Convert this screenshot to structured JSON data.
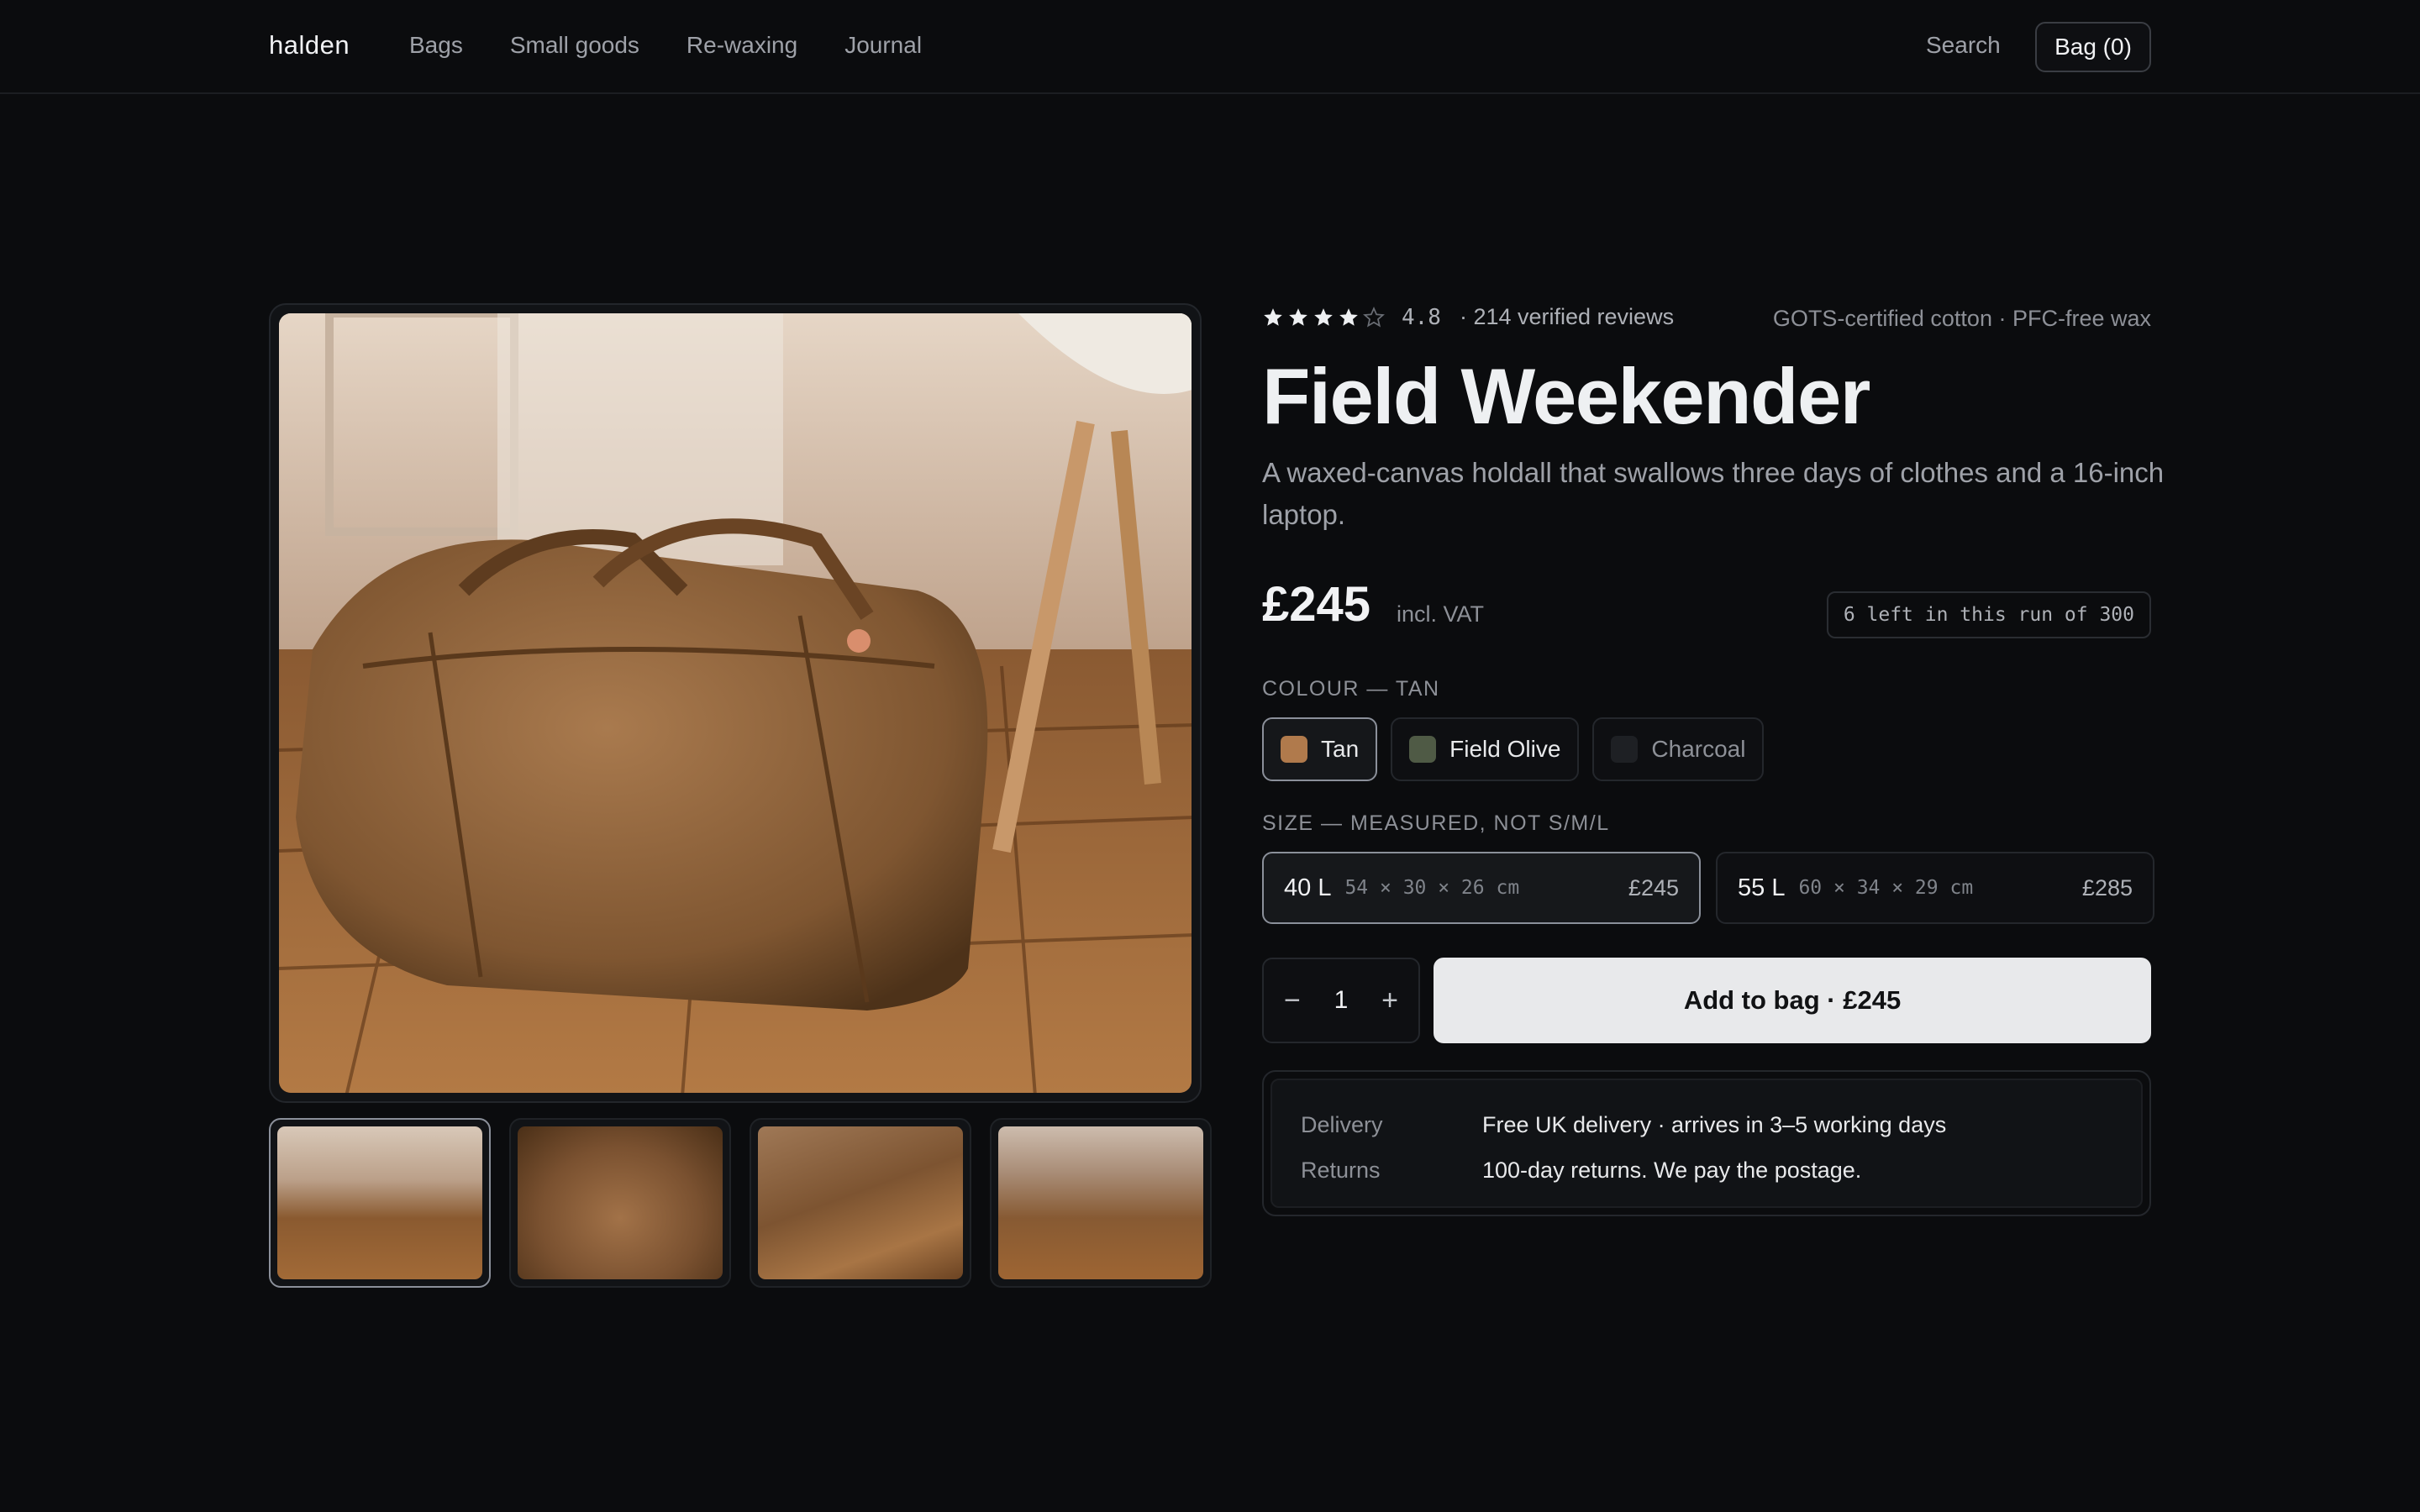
{
  "header": {
    "brand": "halden",
    "nav": [
      "Bags",
      "Small goods",
      "Re-waxing",
      "Journal"
    ],
    "search_label": "Search",
    "bag_label": "Bag (0)"
  },
  "gallery": {
    "thumbnail_count": 4,
    "active_thumbnail": 1
  },
  "product": {
    "rating_stars": 4,
    "rating_max": 5,
    "rating_value": "4.8",
    "reviews": "· 214 verified reviews",
    "certifications": "GOTS-certified cotton · PFC-free wax",
    "title": "Field Weekender",
    "subtitle": "A waxed-canvas holdall that swallows three days of clothes and a 16-inch laptop.",
    "price": "£245",
    "vat": "incl. VAT",
    "stock": "6 left in this run of 300"
  },
  "colour": {
    "label": "COLOUR — TAN",
    "options": [
      {
        "name": "Tan",
        "color": "#b07a4c",
        "selected": true
      },
      {
        "name": "Field Olive",
        "color": "#4f5a45",
        "selected": false
      },
      {
        "name": "Charcoal",
        "color": "#1e2024",
        "selected": false
      }
    ]
  },
  "size": {
    "label": "SIZE — MEASURED, NOT S/M/L",
    "options": [
      {
        "volume": "40 L",
        "dims": "54 × 30 × 26 cm",
        "price": "£245",
        "selected": true
      },
      {
        "volume": "55 L",
        "dims": "60 × 34 × 29 cm",
        "price": "£285",
        "selected": false
      }
    ]
  },
  "purchase": {
    "minus": "−",
    "quantity": "1",
    "plus": "+",
    "add_label": "Add to bag · £245"
  },
  "info": {
    "delivery_key": "Delivery",
    "delivery_val": "Free UK delivery · arrives in 3–5 working days",
    "returns_key": "Returns",
    "returns_val": "100-day returns. We pay the postage."
  }
}
